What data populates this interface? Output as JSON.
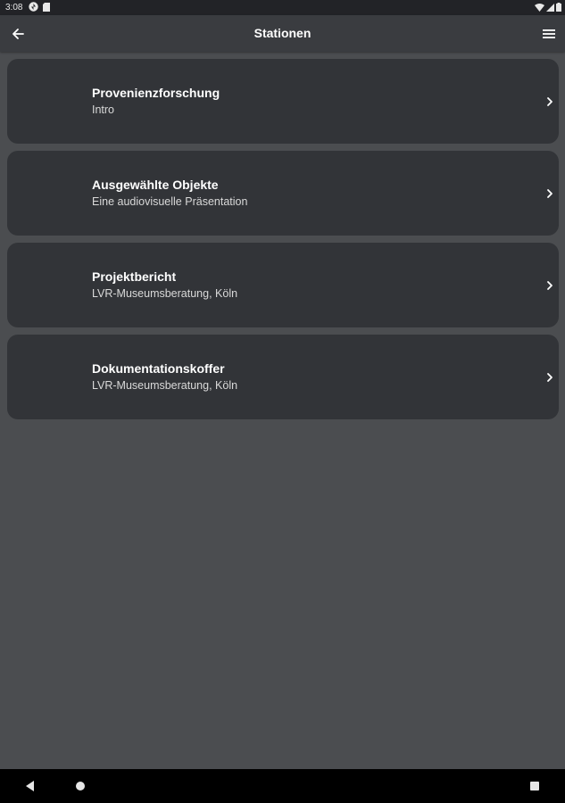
{
  "status_bar": {
    "time": "3:08",
    "left_icons": [
      "pinwheel-app-icon",
      "sd-card-icon"
    ],
    "right_icons": [
      "wifi-icon",
      "signal-icon",
      "battery-icon"
    ]
  },
  "app_bar": {
    "title": "Stationen",
    "back_icon": "arrow-back-icon",
    "menu_icon": "hamburger-menu-icon"
  },
  "stations": [
    {
      "title": "Provenienzforschung",
      "subtitle": "Intro"
    },
    {
      "title": "Ausgewählte Objekte",
      "subtitle": "Eine audiovisuelle Präsentation"
    },
    {
      "title": "Projektbericht",
      "subtitle": "LVR-Museumsberatung, Köln"
    },
    {
      "title": "Dokumentationskoffer",
      "subtitle": "LVR-Museumsberatung, Köln"
    }
  ],
  "nav_bar": {
    "icons": [
      "nav-back-icon",
      "nav-home-icon",
      "nav-recents-icon"
    ]
  },
  "colors": {
    "background": "#4b4d50",
    "card": "#323438",
    "app_bar": "#3a3c40",
    "status_bar": "#222327",
    "nav_bar": "#000000",
    "text_primary": "#ffffff",
    "text_secondary": "#d9d9d9"
  }
}
